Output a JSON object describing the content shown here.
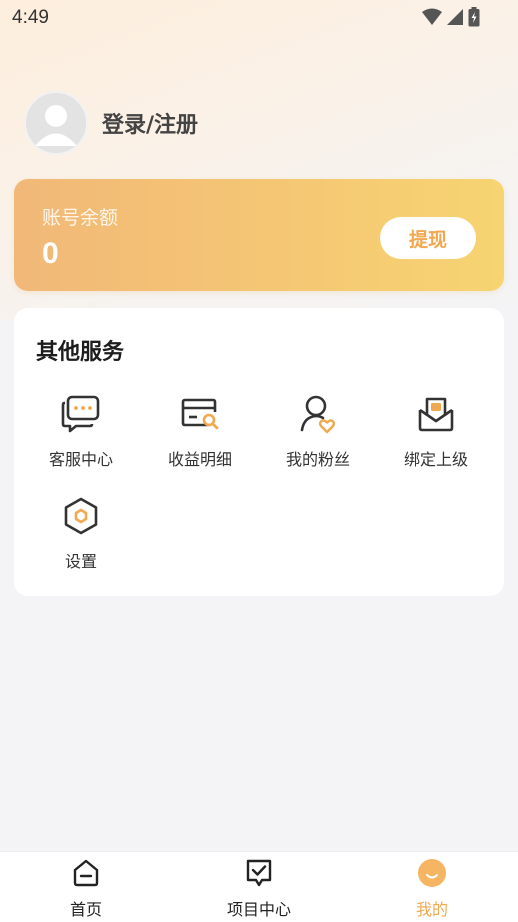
{
  "status_bar": {
    "time": "4:49"
  },
  "profile": {
    "login_label": "登录/注册"
  },
  "balance": {
    "label": "账号余额",
    "value": "0",
    "withdraw_label": "提现"
  },
  "services": {
    "title": "其他服务",
    "items": [
      {
        "label": "客服中心",
        "icon": "customer-service-icon"
      },
      {
        "label": "收益明细",
        "icon": "earnings-detail-icon"
      },
      {
        "label": "我的粉丝",
        "icon": "fans-icon"
      },
      {
        "label": "绑定上级",
        "icon": "bind-superior-icon"
      },
      {
        "label": "设置",
        "icon": "settings-icon"
      }
    ]
  },
  "nav": {
    "items": [
      {
        "label": "首页",
        "icon": "home-icon"
      },
      {
        "label": "项目中心",
        "icon": "project-center-icon"
      },
      {
        "label": "我的",
        "icon": "mine-icon",
        "active": true
      }
    ]
  },
  "colors": {
    "accent": "#f2a84f",
    "card_gradient_start": "#f1b878",
    "card_gradient_end": "#f6d471"
  }
}
